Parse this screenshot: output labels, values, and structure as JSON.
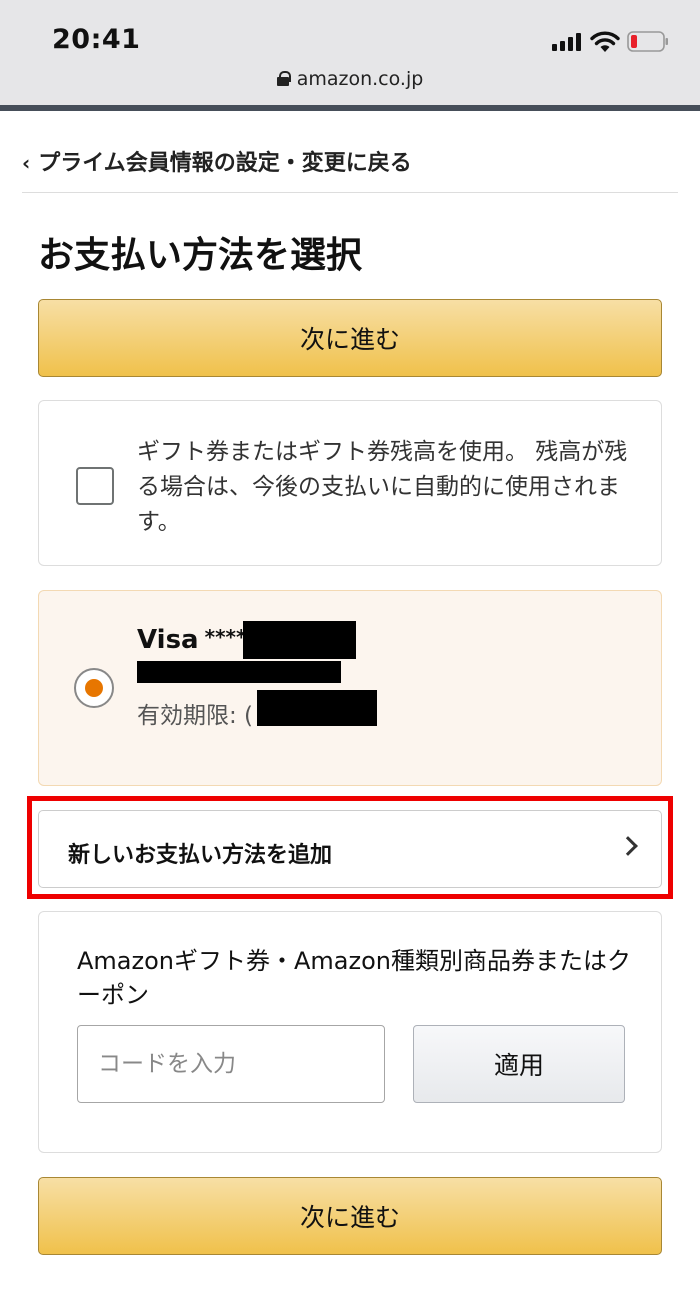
{
  "status_bar": {
    "time": "20:41"
  },
  "browser": {
    "url": "amazon.co.jp"
  },
  "nav": {
    "back_label": "プライム会員情報の設定・変更に戻る"
  },
  "page": {
    "title": "お支払い方法を選択"
  },
  "actions": {
    "continue_top": "次に進む",
    "continue_bottom": "次に進む"
  },
  "gift_option": {
    "checked": false,
    "text": "ギフト券またはギフト券残高を使用。 残高が残る場合は、今後の支払いに自動的に使用されます。"
  },
  "payment_method": {
    "selected": true,
    "brand": "Visa",
    "masked_number": "****",
    "expiry_label": "有効期限: ("
  },
  "add_payment": {
    "label": "新しいお支払い方法を追加"
  },
  "coupon": {
    "label": "Amazonギフト券・Amazon種類別商品券またはクーポン",
    "input_placeholder": "コードを入力",
    "input_value": "",
    "apply_label": "適用"
  },
  "colors": {
    "accent_yellow": "#f0c14b",
    "radio_orange": "#e77600",
    "highlight_red": "#ee0000"
  }
}
